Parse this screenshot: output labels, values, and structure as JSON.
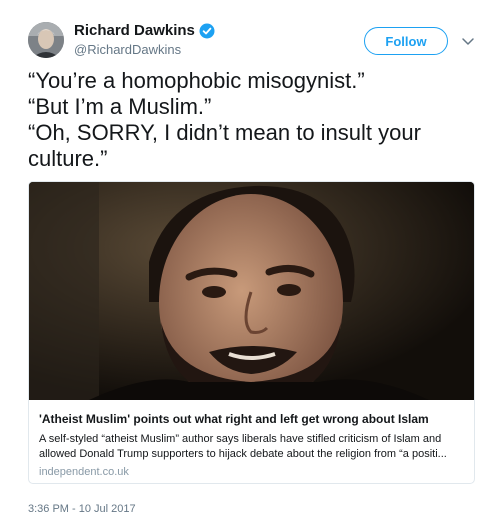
{
  "author": {
    "name": "Richard Dawkins",
    "handle": "@RichardDawkins",
    "verified": true
  },
  "follow_button": {
    "label": "Follow"
  },
  "tweet": {
    "lines": [
      "“You’re a homophobic misogynist.”",
      "“But I’m a Muslim.”",
      "“Oh, SORRY, I didn’t mean to insult your",
      "culture.”"
    ]
  },
  "card": {
    "title": "'Atheist Muslim' points out what right and left get wrong about Islam",
    "description_lines": [
      "A self-styled “atheist Muslim” author says liberals have stifled criticism of Islam and",
      "allowed Donald Trump supporters to hijack debate about the religion from “a positi..."
    ],
    "domain": "independent.co.uk"
  },
  "timestamp": "3:36 PM - 10 Jul 2017",
  "icons": {
    "verified": "verified-badge-icon",
    "more": "chevron-down-icon"
  },
  "colors": {
    "accent": "#1da1f2",
    "text": "#14171a",
    "secondary": "#657786",
    "border": "#e1e8ed"
  }
}
